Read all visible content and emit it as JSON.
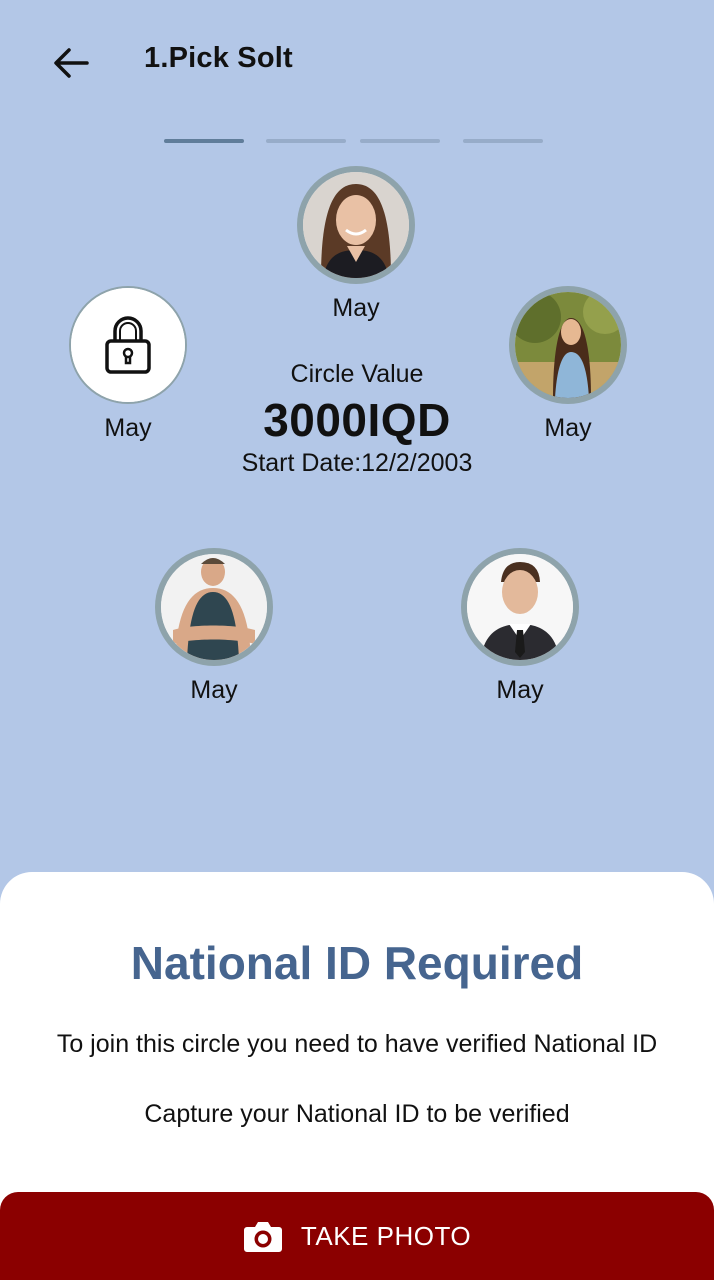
{
  "header": {
    "title": "1.Pick Solt",
    "back_icon": "arrow-left-icon",
    "steps_total": 4,
    "step_active": 1
  },
  "circle": {
    "value_label": "Circle Value",
    "value_amount": "3000IQD",
    "start_date": "Start Date:12/2/2003"
  },
  "members": [
    {
      "position": "top",
      "label": "May",
      "avatar": "woman-brown-hair-photo"
    },
    {
      "position": "left",
      "label": "May",
      "avatar": "lock-icon",
      "locked": true
    },
    {
      "position": "right",
      "label": "May",
      "avatar": "woman-outdoor-photo"
    },
    {
      "position": "bottom-left",
      "label": "May",
      "avatar": "man-tank-top-photo"
    },
    {
      "position": "bottom-right",
      "label": "May",
      "avatar": "man-suit-photo"
    }
  ],
  "sheet": {
    "title": "National ID Required",
    "line1": "To join this circle you need to have verified National ID",
    "line2": "Capture your National ID to be verified"
  },
  "action": {
    "label": "TAKE PHOTO",
    "icon": "camera-icon"
  },
  "colors": {
    "background": "#b3c7e7",
    "accent_title": "#46658f",
    "button": "#8b0000",
    "avatar_ring": "#8ea3ab"
  }
}
